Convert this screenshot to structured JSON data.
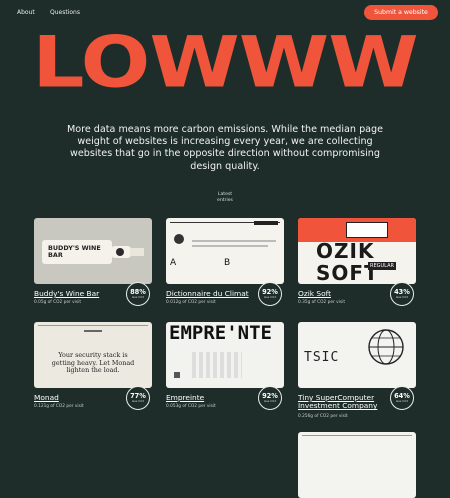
{
  "nav": {
    "about": "About",
    "questions": "Questions",
    "submit": "Submit a website"
  },
  "logo": "LOWWW",
  "intro": "More data means more carbon emissions. While the median page weight of websites is increasing every year, we are collecting websites that go in the opposite direction without compromising design quality.",
  "latest": {
    "line1": "Latest",
    "line2": "entries"
  },
  "badge_sub": "less CO2",
  "cards": [
    {
      "title": "Buddy's Wine Bar",
      "meta": "0.05g of CO2 per visit",
      "pct": "88%",
      "thumb_text": "BUDDY'S WINE BAR"
    },
    {
      "title": "Dictionnaire du Climat",
      "meta": "0.012g of CO2 per visit",
      "pct": "92%",
      "thumb_a": "A",
      "thumb_b": "B"
    },
    {
      "title": "Ozik Soft",
      "meta": "0.35g of CO2 per visit",
      "pct": "43%",
      "thumb_big": "OZIK SOFT",
      "thumb_small": "REGULAR"
    },
    {
      "title": "Monad",
      "meta": "0.121g of CO2 per visit",
      "pct": "77%",
      "thumb_text": "Your security stack is getting heavy. Let Monad lighten the load."
    },
    {
      "title": "Empreinte",
      "meta": "0.053g of CO2 per visit",
      "pct": "92%",
      "thumb_text": "EMPRE'NTE"
    },
    {
      "title": "Tiny SuperComputer Investment Company",
      "meta": "0.256g of CO2 per visit",
      "pct": "64%",
      "thumb_text": "TSIC"
    }
  ],
  "colors": {
    "background": "#1e2d29",
    "accent": "#f0553b"
  }
}
